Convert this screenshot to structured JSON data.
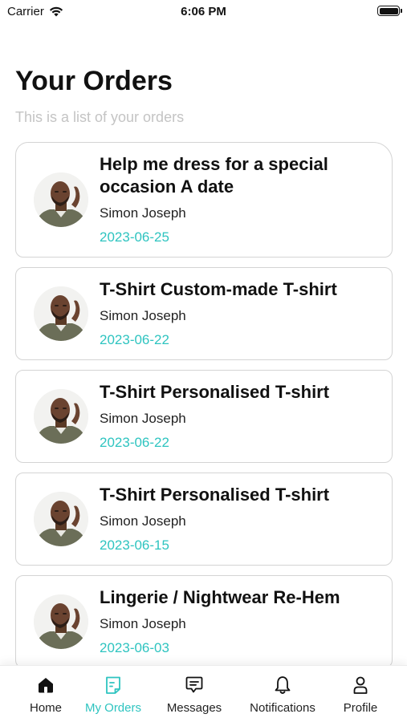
{
  "status_bar": {
    "carrier": "Carrier",
    "time": "6:06 PM"
  },
  "header": {
    "title": "Your Orders",
    "subtitle": "This is a list of your orders"
  },
  "orders": [
    {
      "title": "Help me dress for a special occasion A date",
      "seller": "Simon Joseph",
      "date": "2023-06-25"
    },
    {
      "title": "T-Shirt Custom-made T-shirt",
      "seller": "Simon Joseph",
      "date": "2023-06-22"
    },
    {
      "title": "T-Shirt Personalised T-shirt",
      "seller": "Simon Joseph",
      "date": "2023-06-22"
    },
    {
      "title": "T-Shirt Personalised T-shirt",
      "seller": "Simon Joseph",
      "date": "2023-06-15"
    },
    {
      "title": "Lingerie / Nightwear Re-Hem",
      "seller": "Simon Joseph",
      "date": "2023-06-03"
    }
  ],
  "tabbar": {
    "home": "Home",
    "my_orders": "My Orders",
    "messages": "Messages",
    "notifications": "Notifications",
    "profile": "Profile",
    "active_tab": "my_orders"
  },
  "colors": {
    "accent": "#2ec4c0",
    "subtitle": "#c4c4c4",
    "card_border": "#d4d4d4"
  },
  "icons": {
    "home": "home-icon",
    "my_orders": "orders-icon",
    "messages": "chat-icon",
    "notifications": "bell-icon",
    "profile": "person-icon"
  }
}
